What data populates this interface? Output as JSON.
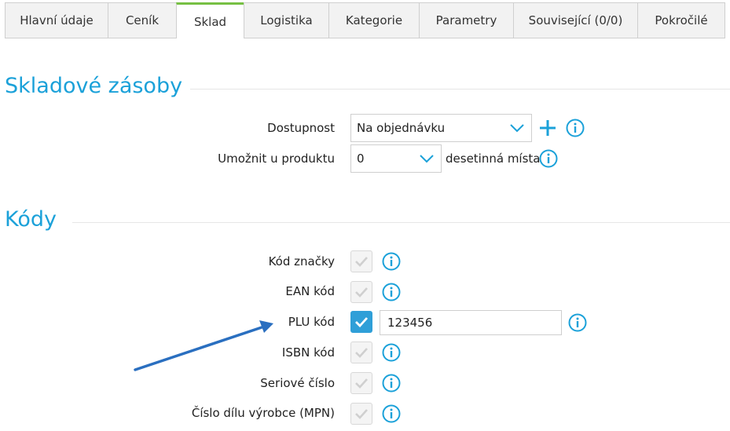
{
  "tabs": [
    {
      "label": "Hlavní údaje",
      "active": false
    },
    {
      "label": "Ceník",
      "active": false
    },
    {
      "label": "Sklad",
      "active": true
    },
    {
      "label": "Logistika",
      "active": false
    },
    {
      "label": "Kategorie",
      "active": false
    },
    {
      "label": "Parametry",
      "active": false
    },
    {
      "label": "Související (0/0)",
      "active": false
    },
    {
      "label": "Pokročilé",
      "active": false
    }
  ],
  "stock": {
    "title": "Skladové zásoby",
    "availability_label": "Dostupnost",
    "availability_value": "Na objednávku",
    "allow_label": "Umožnit u produktu",
    "allow_value": "0",
    "decimals_label": "desetinná místa"
  },
  "codes": {
    "title": "Kódy",
    "items": [
      {
        "label": "Kód značky",
        "checked": false
      },
      {
        "label": "EAN kód",
        "checked": false
      },
      {
        "label": "PLU kód",
        "checked": true,
        "value": "123456"
      },
      {
        "label": "ISBN kód",
        "checked": false
      },
      {
        "label": "Seriové číslo",
        "checked": false
      },
      {
        "label": "Číslo dílu výrobce (MPN)",
        "checked": false
      }
    ]
  },
  "colors": {
    "accent": "#1ba1d9",
    "tab_active_top": "#76c043",
    "checkbox_on": "#2f9fd8",
    "annotation_arrow": "#2a6fc0"
  },
  "icons": {
    "info": "info-circle-icon",
    "plus": "plus-icon",
    "chevron": "chevron-down-icon",
    "check": "checkmark-icon"
  }
}
